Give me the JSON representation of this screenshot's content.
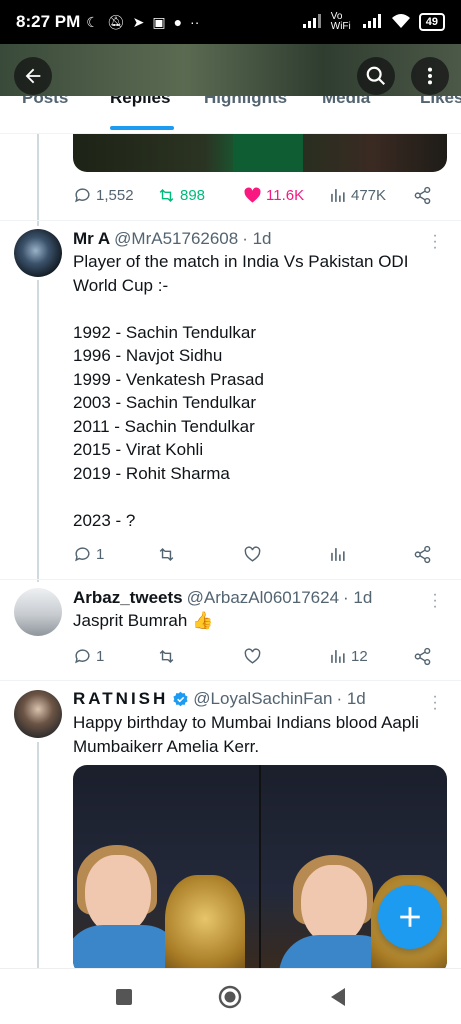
{
  "status_bar": {
    "time": "8:27 PM",
    "network_label": "Vo WiFi",
    "battery": "49"
  },
  "tabs": [
    {
      "label": "Posts"
    },
    {
      "label": "Replies"
    },
    {
      "label": "Highlights"
    },
    {
      "label": "Media"
    },
    {
      "label": "Likes"
    }
  ],
  "main_post_stats": {
    "replies": "1,552",
    "reposts": "898",
    "likes": "11.6K",
    "views": "477K"
  },
  "tweets": [
    {
      "name": "Mr A",
      "handle": "@MrA51762608",
      "time": "· 1d",
      "text": "Player of the match in India Vs Pakistan ODI World Cup :-\n\n1992 - Sachin Tendulkar\n1996 - Navjot Sidhu\n1999 - Venkatesh Prasad\n2003 - Sachin Tendulkar\n2011 - Sachin Tendulkar\n2015 - Virat Kohli\n2019 - Rohit Sharma\n\n2023 - ?",
      "replies": "1",
      "views": ""
    },
    {
      "name": "Arbaz_tweets",
      "handle": "@ArbazAl06017624",
      "time": "· 1d",
      "text": "Jasprit Bumrah 👍",
      "replies": "1",
      "views": "12"
    },
    {
      "name": "RATNISH",
      "handle": "@LoyalSachinFan",
      "time": "· 1d",
      "text": "Happy birthday to Mumbai Indians blood Aapli Mumbaikerr Amelia Kerr."
    }
  ],
  "colors": {
    "accent": "#1d9bf0",
    "like": "#f91880",
    "repost": "#00ba7c",
    "muted": "#536471"
  }
}
